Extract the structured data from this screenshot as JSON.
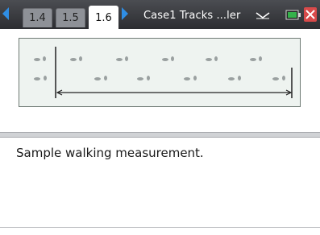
{
  "tabs": [
    {
      "label": "1.4",
      "active": false
    },
    {
      "label": "1.5",
      "active": false
    },
    {
      "label": "1.6",
      "active": true
    }
  ],
  "document": {
    "title": "Case1 Tracks ...ler"
  },
  "icons": {
    "prev": "left-arrow-icon",
    "next": "right-arrow-icon",
    "menu": "chevron-down-icon",
    "battery": "battery-icon",
    "close": "close-icon",
    "footprints": "footprints-icon"
  },
  "notes": {
    "text": "Sample walking measurement."
  },
  "colors": {
    "accent": "#2f8ee5",
    "close": "#d84a4a",
    "battery": "#35b24b"
  }
}
